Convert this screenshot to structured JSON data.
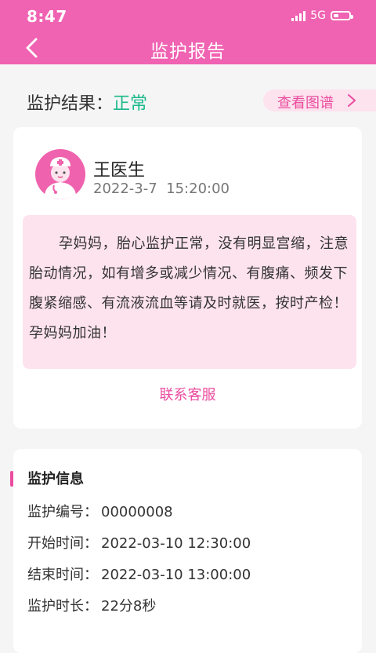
{
  "status_bar": {
    "time": "8:47",
    "network": "5G"
  },
  "nav": {
    "title": "监护报告",
    "back_icon": "back-arrow-icon"
  },
  "result": {
    "label": "监护结果：",
    "value": "正常",
    "value_color": "#1cb98b",
    "view_chart": "查看图谱"
  },
  "doctor": {
    "name": "王医生",
    "time": "2022-3-7  15:20:00",
    "message": "孕妈妈，胎心监护正常，没有明显宫缩，注意胎动情况，如有增多或减少情况、有腹痛、频发下腹紧缩感、有流液流血等请及时就医，按时产检！孕妈妈加油！",
    "contact": "联系客服"
  },
  "info": {
    "title": "监护信息",
    "rows": [
      {
        "key": "监护编号：",
        "value": "00000008"
      },
      {
        "key": "开始时间：",
        "value": "2022-03-10 12:30:00"
      },
      {
        "key": "结束时间：",
        "value": "2022-03-10 13:00:00"
      },
      {
        "key": "监护时长：",
        "value": "22分8秒"
      }
    ]
  },
  "colors": {
    "brand": "#f062b2",
    "accent": "#ea4c9f",
    "soft_pink": "#fde3ee"
  }
}
